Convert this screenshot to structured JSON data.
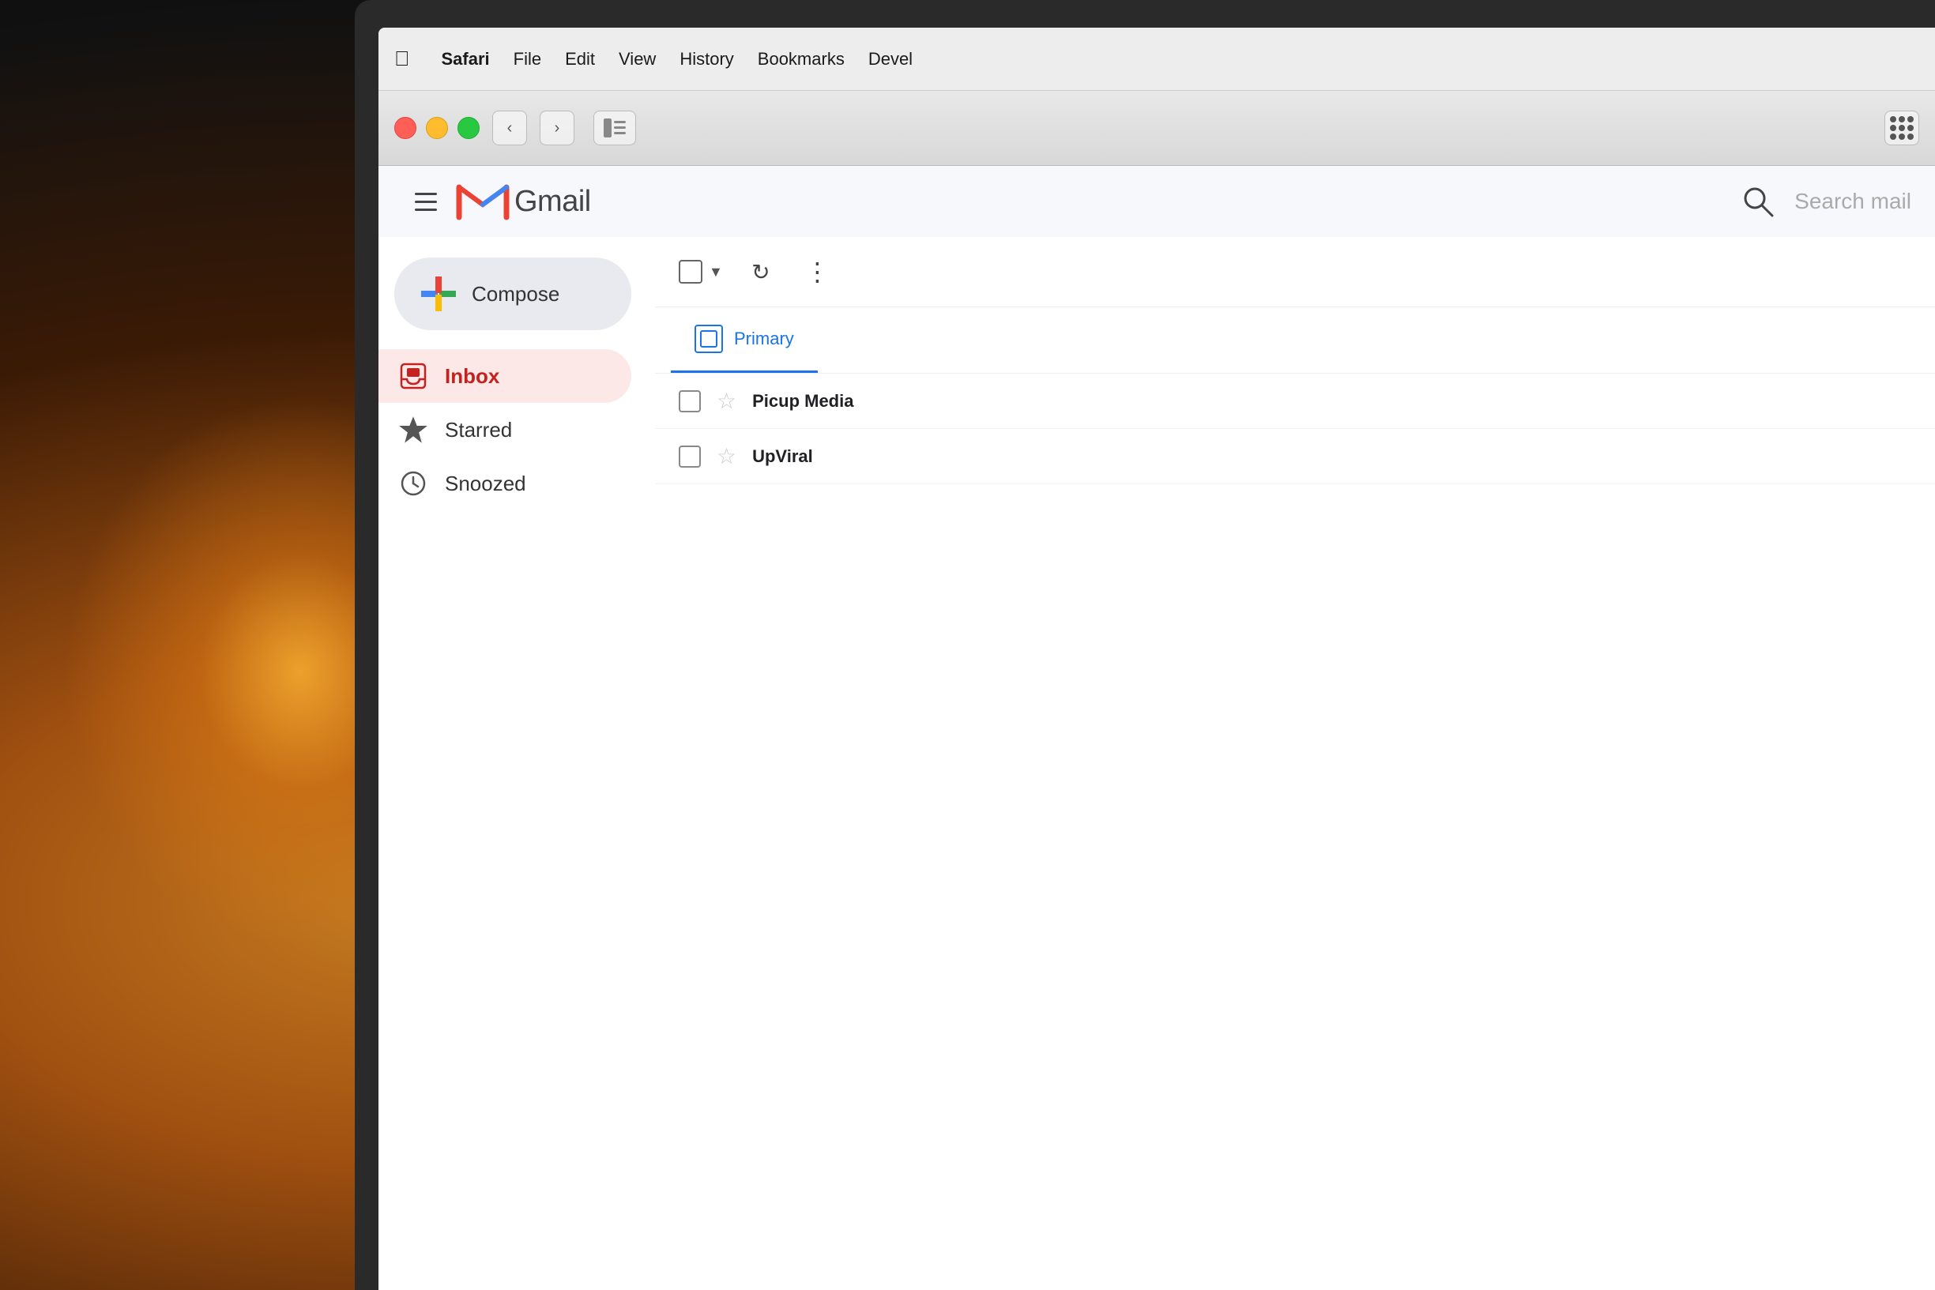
{
  "background": {
    "color": "#1a1a1a"
  },
  "menubar": {
    "apple_label": "",
    "safari_label": "Safari",
    "file_label": "File",
    "edit_label": "Edit",
    "view_label": "View",
    "history_label": "History",
    "bookmarks_label": "Bookmarks",
    "develop_label": "Devel"
  },
  "browser": {
    "back_icon": "‹",
    "forward_icon": "›",
    "sidebar_icon": "⊡",
    "grid_icon": "grid"
  },
  "gmail": {
    "hamburger_label": "menu",
    "logo_m": "M",
    "wordmark": "Gmail",
    "search_placeholder": "Search mail",
    "compose_label": "Compose",
    "nav_items": [
      {
        "id": "inbox",
        "label": "Inbox",
        "icon": "inbox",
        "active": true
      },
      {
        "id": "starred",
        "label": "Starred",
        "icon": "star"
      },
      {
        "id": "snoozed",
        "label": "Snoozed",
        "icon": "clock"
      }
    ],
    "toolbar": {
      "refresh_icon": "↻",
      "more_icon": "⋮"
    },
    "tabs": [
      {
        "id": "primary",
        "label": "Primary",
        "active": true
      }
    ],
    "emails": [
      {
        "id": "1",
        "sender": "Picup Media",
        "starred": false
      },
      {
        "id": "2",
        "sender": "UpViral",
        "starred": false
      }
    ]
  }
}
